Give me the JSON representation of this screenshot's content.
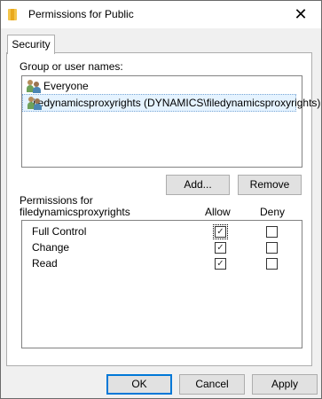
{
  "window": {
    "title": "Permissions for Public",
    "close_symbol": "✕"
  },
  "tabs": [
    {
      "label": "Security"
    }
  ],
  "group": {
    "label": "Group or user names:",
    "items": [
      {
        "name": "Everyone",
        "icon": "users-icon",
        "selected": false
      },
      {
        "name": "filedynamicsproxyrights (DYNAMICS\\filedynamicsproxyrights)",
        "icon": "users-icon",
        "selected": true
      }
    ]
  },
  "buttons": {
    "add": "Add...",
    "remove": "Remove",
    "ok": "OK",
    "cancel": "Cancel",
    "apply": "Apply"
  },
  "permissions": {
    "label_line1": "Permissions for",
    "label_line2": "filedynamicsproxyrights",
    "allow_header": "Allow",
    "deny_header": "Deny",
    "rows": [
      {
        "name": "Full Control",
        "allow": true,
        "deny": false
      },
      {
        "name": "Change",
        "allow": true,
        "deny": false
      },
      {
        "name": "Read",
        "allow": true,
        "deny": false
      }
    ]
  },
  "colors": {
    "accent": "#0078d7",
    "selection": "#e5f3ff"
  }
}
